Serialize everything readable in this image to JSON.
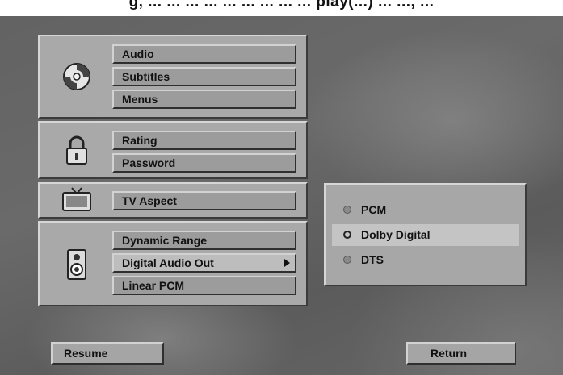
{
  "header": {
    "partial_text": "g, ... ... ... ... ... ... ... ... ... play(...) ... ..., ..."
  },
  "groups": {
    "disc": {
      "icon": "disc-icon",
      "items": [
        {
          "label": "Audio"
        },
        {
          "label": "Subtitles"
        },
        {
          "label": "Menus"
        }
      ]
    },
    "lock": {
      "icon": "padlock-icon",
      "items": [
        {
          "label": "Rating"
        },
        {
          "label": "Password"
        }
      ]
    },
    "tv": {
      "icon": "tv-icon",
      "items": [
        {
          "label": "TV Aspect"
        }
      ]
    },
    "speaker": {
      "icon": "speaker-icon",
      "items": [
        {
          "label": "Dynamic Range"
        },
        {
          "label": "Digital Audio Out",
          "selected": true,
          "has_submenu": true
        },
        {
          "label": "Linear PCM"
        }
      ]
    }
  },
  "submenu": {
    "options": [
      {
        "label": "PCM",
        "state": "unselected"
      },
      {
        "label": "Dolby Digital",
        "state": "highlighted"
      },
      {
        "label": "DTS",
        "state": "unselected"
      }
    ]
  },
  "footer": {
    "resume_label": "Resume",
    "return_label": "Return"
  },
  "colors": {
    "panel": "#a9a9a9",
    "button": "#9c9c9c",
    "highlight": "#c4c4c4",
    "background": "#636363"
  }
}
